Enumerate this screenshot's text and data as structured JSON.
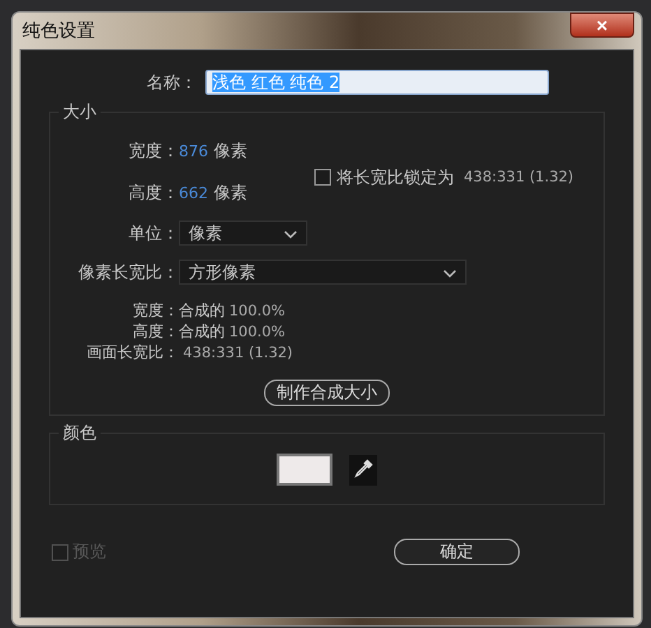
{
  "window": {
    "title": "纯色设置",
    "close": "×"
  },
  "name_field": {
    "label": "名称：",
    "value": "浅色 红色 纯色 2",
    "text_selected": true
  },
  "size_group": {
    "title": "大小",
    "width": {
      "label": "宽度：",
      "value": "876",
      "unit": "像素"
    },
    "height": {
      "label": "高度：",
      "value": "662",
      "unit": "像素"
    },
    "lock_ratio": {
      "label": "将长宽比锁定为",
      "ratio": "438:331 (1.32)",
      "checked": false
    },
    "unit": {
      "label": "单位：",
      "value": "像素"
    },
    "pixel_aspect": {
      "label": "像素长宽比：",
      "value": "方形像素"
    },
    "info": [
      {
        "label": "宽度：",
        "value": "合成的",
        "percent": "100.0%"
      },
      {
        "label": "高度：",
        "value": "合成的",
        "percent": "100.0%"
      }
    ],
    "frame_aspect": {
      "label": "画面长宽比：",
      "value": "438:331 (1.32)"
    },
    "button": "制作合成大小"
  },
  "color_group": {
    "title": "颜色",
    "color": "#eeeaea"
  },
  "preview": {
    "label": "预览",
    "checked": false,
    "disabled": true
  },
  "ok_button": "确定"
}
